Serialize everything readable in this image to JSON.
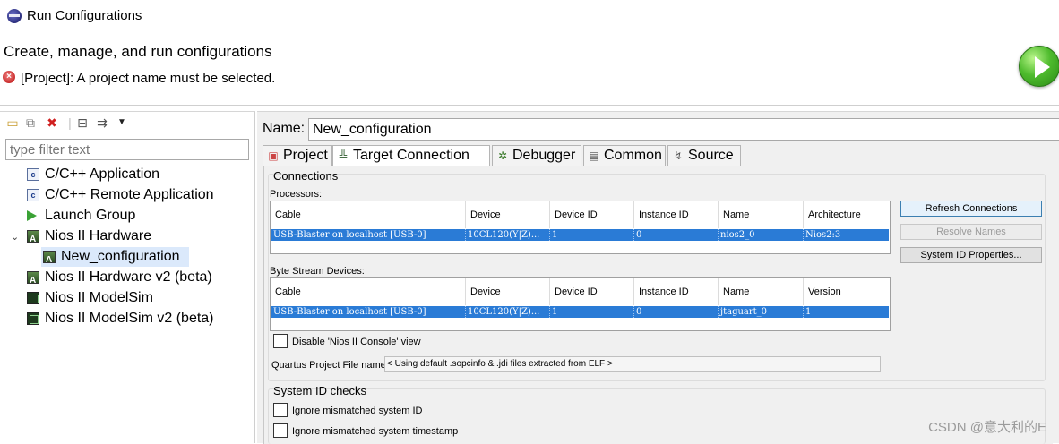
{
  "window": {
    "title": "Run Configurations"
  },
  "header": {
    "heading": "Create, manage, and run configurations",
    "error": "[Project]: A project name must be selected."
  },
  "sidebar": {
    "filter_placeholder": "type filter text",
    "items": [
      {
        "label": "C/C++ Application",
        "icon": "c-app-icon"
      },
      {
        "label": "C/C++ Remote Application",
        "icon": "c-app-icon"
      },
      {
        "label": "Launch Group",
        "icon": "launch-icon"
      },
      {
        "label": "Nios II Hardware",
        "icon": "nios-hardware-icon",
        "expanded": true
      },
      {
        "label": "New_configuration",
        "icon": "nios-hardware-icon",
        "selected": true
      },
      {
        "label": "Nios II Hardware v2 (beta)",
        "icon": "nios-hardware-icon"
      },
      {
        "label": "Nios II ModelSim",
        "icon": "modelsim-icon"
      },
      {
        "label": "Nios II ModelSim v2 (beta)",
        "icon": "modelsim-icon"
      }
    ]
  },
  "config": {
    "name_label": "Name:",
    "name_value": "New_configuration",
    "tabs": [
      {
        "label": "Project"
      },
      {
        "label": "Target Connection",
        "active": true
      },
      {
        "label": "Debugger"
      },
      {
        "label": "Common"
      },
      {
        "label": "Source"
      }
    ]
  },
  "connections": {
    "title": "Connections",
    "processors_label": "Processors:",
    "processors_columns": [
      "Cable",
      "Device",
      "Device ID",
      "Instance ID",
      "Name",
      "Architecture"
    ],
    "processors_row": [
      "USB-Blaster on localhost [USB-0]",
      "10CL120(Y|Z)...",
      "1",
      "0",
      "nios2_0",
      "Nios2:3"
    ],
    "byte_stream_label": "Byte Stream Devices:",
    "byte_stream_columns": [
      "Cable",
      "Device",
      "Device ID",
      "Instance ID",
      "Name",
      "Version"
    ],
    "byte_stream_row": [
      "USB-Blaster on localhost [USB-0]",
      "10CL120(Y|Z)...",
      "1",
      "0",
      "jtaguart_0",
      "1"
    ],
    "buttons": {
      "refresh": "Refresh Connections",
      "resolve": "Resolve Names",
      "system_id": "System ID Properties..."
    },
    "disable_console_label": "Disable 'Nios II Console' view",
    "quartus_label": "Quartus Project File name:",
    "quartus_value": "< Using default .sopcinfo & .jdi files extracted from ELF >"
  },
  "system_id": {
    "title": "System ID checks",
    "ignore_id_label": "Ignore mismatched system ID",
    "ignore_timestamp_label": "Ignore mismatched system timestamp"
  },
  "watermark": "CSDN @意大利的E"
}
